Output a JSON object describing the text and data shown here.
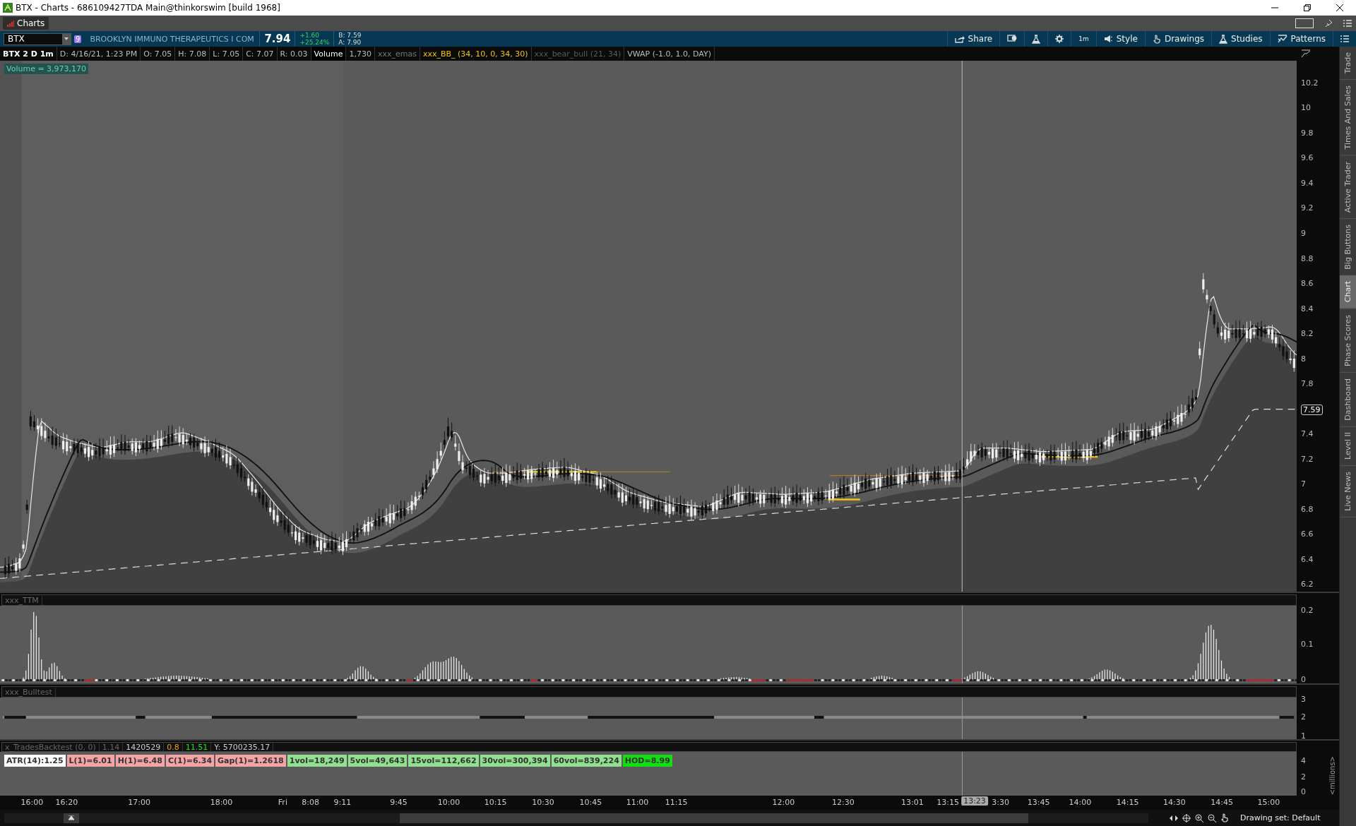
{
  "window": {
    "title": "BTX - Charts - 686109427TDA Main@thinkorswim [build 1968]"
  },
  "tabs": [
    {
      "label": "Charts",
      "selected": true
    }
  ],
  "symbol_bar": {
    "symbol": "BTX",
    "badge": "9",
    "company": "BROOKLYN IMMUNO THERAPEUTICS I COM",
    "last": "7.94",
    "change": "+1.60",
    "change_pct": "+25.24%",
    "bid": "B: 7.59",
    "ask": "A: 7.90",
    "tools": [
      {
        "label": "Share",
        "kind": "share"
      },
      {
        "kind": "alert"
      },
      {
        "kind": "flask"
      },
      {
        "kind": "gear"
      },
      {
        "label": "1m",
        "kind": "text"
      },
      {
        "label": "Style",
        "kind": "style"
      },
      {
        "label": "Drawings",
        "kind": "hand"
      },
      {
        "label": "Studies",
        "kind": "flask"
      },
      {
        "label": "Patterns",
        "kind": "pattern"
      },
      {
        "kind": "menu"
      }
    ]
  },
  "study_bar": [
    {
      "text": "BTX 2 D 1m",
      "kind": "title"
    },
    {
      "text": "D: 4/16/21, 1:23 PM",
      "kind": "value"
    },
    {
      "text": "O: 7.05",
      "kind": "value"
    },
    {
      "text": "H: 7.08",
      "kind": "value"
    },
    {
      "text": "L: 7.05",
      "kind": "value"
    },
    {
      "text": "C: 7.07",
      "kind": "value"
    },
    {
      "text": "R: 0.03",
      "kind": "value"
    },
    {
      "text": "Volume",
      "kind": "label"
    },
    {
      "text": "1,730",
      "kind": "value"
    },
    {
      "text": "xxx_emas",
      "kind": "dim"
    },
    {
      "text": "xxx_BB_ (34, 10, 0, 34, 30)",
      "kind": "active"
    },
    {
      "text": "xxx_bear_bull (21, 34)",
      "kind": "hidden"
    },
    {
      "text": "VWAP (-1.0, 1.0, DAY)",
      "kind": "value"
    }
  ],
  "price_pane": {
    "volume_label": "Volume = 3,973,170",
    "y_axis": [
      "10.2",
      "10",
      "9.8",
      "9.6",
      "9.4",
      "9.2",
      "9",
      "8.8",
      "8.6",
      "8.4",
      "8.2",
      "8",
      "7.8",
      "7.4",
      "7.2",
      "7",
      "6.8",
      "6.6",
      "6.4",
      "6.2"
    ],
    "last_price_tag": "7.59"
  },
  "ttm_pane": {
    "title": "xxx_TTM",
    "y_axis": [
      "0.2",
      "0.1",
      "0"
    ]
  },
  "bulltest_pane": {
    "title": "xxx_Bulltest",
    "y_axis": [
      "3",
      "2",
      "1"
    ]
  },
  "backtest_pane": {
    "header": [
      {
        "text": "x_TradesBacktest (0, 0)",
        "kind": "dim"
      },
      {
        "text": "1.14",
        "kind": "dim"
      },
      {
        "text": "1420529",
        "kind": "plain"
      },
      {
        "text": "0.8",
        "kind": "orange"
      },
      {
        "text": "11.51",
        "kind": "green"
      },
      {
        "text": "Y: 5700235.17",
        "kind": "plain"
      }
    ],
    "labels": [
      {
        "text": "ATR(14):1.25",
        "color": "#ffffff"
      },
      {
        "text": "L(1)=6.01",
        "color": "#f4a4a4"
      },
      {
        "text": "H(1)=6.48",
        "color": "#f4a4a4"
      },
      {
        "text": "C(1)=6.34",
        "color": "#f4a4a4"
      },
      {
        "text": "Gap(1)=1.2618",
        "color": "#f4a4a4"
      },
      {
        "text": "1vol=18,249",
        "color": "#90e090"
      },
      {
        "text": "5vol=49,643",
        "color": "#90e090"
      },
      {
        "text": "15vol=112,662",
        "color": "#90e090"
      },
      {
        "text": "30vol=300,394",
        "color": "#90e090"
      },
      {
        "text": "60vol=839,224",
        "color": "#90e090"
      },
      {
        "text": "HOD=8.99",
        "color": "#10e010"
      }
    ],
    "y_axis": [
      "4",
      "2",
      "0"
    ],
    "unit": "<millions>"
  },
  "time_axis": {
    "labels": [
      "16:00",
      "16:20",
      "17:00",
      "18:00",
      "Fri",
      "8:08",
      "9:11",
      "9:45",
      "10:00",
      "10:15",
      "10:30",
      "10:45",
      "11:00",
      "11:15",
      "12:00",
      "12:30",
      "13:01",
      "13:15",
      "3:30",
      "13:45",
      "14:00",
      "14:15",
      "14:30",
      "14:45",
      "15:00"
    ],
    "cursor": "13:23"
  },
  "status": {
    "drawing_set": "Drawing set: Default"
  },
  "side_tabs": [
    {
      "label": "Trade",
      "selected": false
    },
    {
      "label": "Times And Sales",
      "selected": false
    },
    {
      "label": "Active Trader",
      "selected": false
    },
    {
      "label": "Big Buttons",
      "selected": false
    },
    {
      "label": "Chart",
      "selected": true
    },
    {
      "label": "Phase Scores",
      "selected": false
    },
    {
      "label": "Dashboard",
      "selected": false
    },
    {
      "label": "Level II",
      "selected": false
    },
    {
      "label": "Live News",
      "selected": false
    }
  ]
}
